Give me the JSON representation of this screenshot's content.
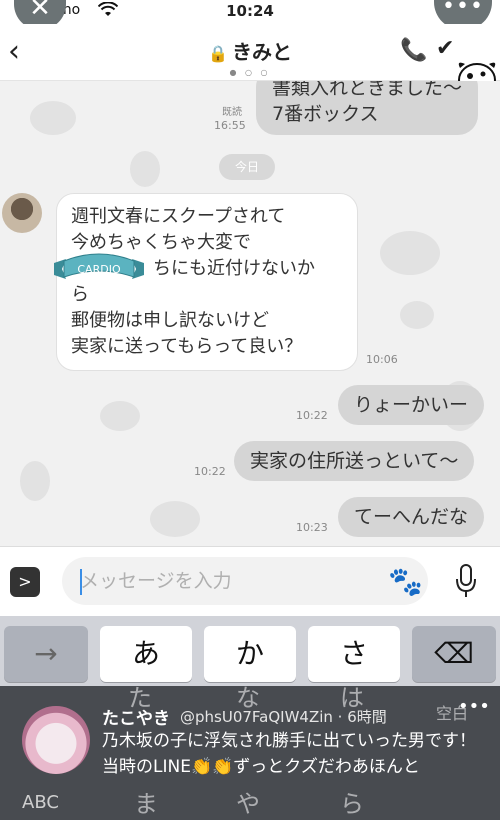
{
  "status": {
    "carrier": "mo",
    "time": "10:24",
    "close_glyph": "✕",
    "more_glyph": "•••"
  },
  "header": {
    "title": "きみと",
    "page_dots": "● ○ ○"
  },
  "chat": {
    "date_label": "今日",
    "messages": [
      {
        "side": "right",
        "text": "書類入れときました〜\n7番ボックス",
        "read": "既読",
        "time": "16:55"
      },
      {
        "side": "left",
        "lines": [
          "週刊文春にスクープされて",
          "今めちゃくちゃ大変で",
          "ちにも近付けないか",
          "ら",
          "郵便物は申し訳ないけど",
          "実家に送ってもらって良い？"
        ],
        "time": "10:06",
        "sticker": "CARDIO"
      },
      {
        "side": "right",
        "text": "りょーかいー",
        "time": "10:22"
      },
      {
        "side": "right",
        "text": "実家の住所送っといて〜",
        "time": "10:22"
      },
      {
        "side": "right",
        "text": "てーへんだな",
        "time": "10:23"
      }
    ]
  },
  "input": {
    "placeholder": "メッセージを入力"
  },
  "keyboard": {
    "row1": [
      "→",
      "あ",
      "か",
      "さ",
      "⌫"
    ],
    "row2": [
      "た",
      "な",
      "は",
      "空白"
    ],
    "row3": [
      "ABC",
      "ま",
      "や",
      "ら"
    ]
  },
  "notification": {
    "name": "たこやき",
    "handle": "@phsU07FaQIW4Zin · 6時間",
    "text": "乃木坂の子に浮気され勝手に出ていった男です！当時のLINE👏👏ずっとクズだわあほんと"
  }
}
